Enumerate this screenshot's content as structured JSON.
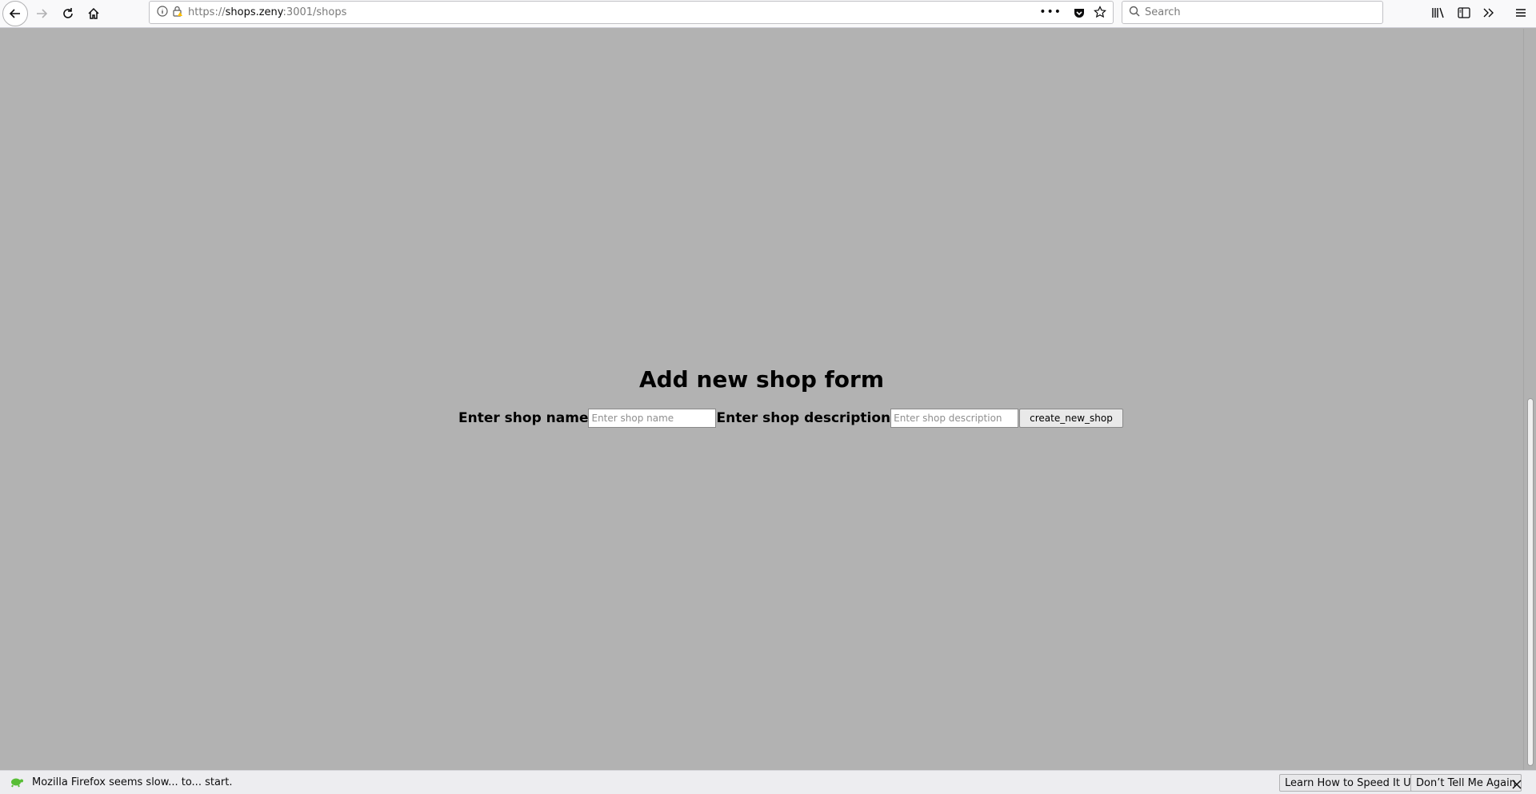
{
  "browser": {
    "url_prefix": "https://",
    "url_host": "shops.zeny",
    "url_rest": ":3001/shops",
    "search_placeholder": "Search"
  },
  "form": {
    "title": "Add new shop form",
    "name_label": "Enter shop name",
    "name_placeholder": "Enter shop name",
    "description_label": "Enter shop description",
    "description_placeholder": "Enter shop description",
    "submit_label": "create_new_shop"
  },
  "notification": {
    "message": "Mozilla Firefox seems slow... to... start.",
    "learn_button": "Learn How to Speed It Up",
    "dismiss_button": "Don’t Tell Me Again"
  },
  "colors": {
    "page_background": "#b2b2b2",
    "toolbar_background": "#f9f9fa",
    "notification_background": "#ededf0"
  }
}
